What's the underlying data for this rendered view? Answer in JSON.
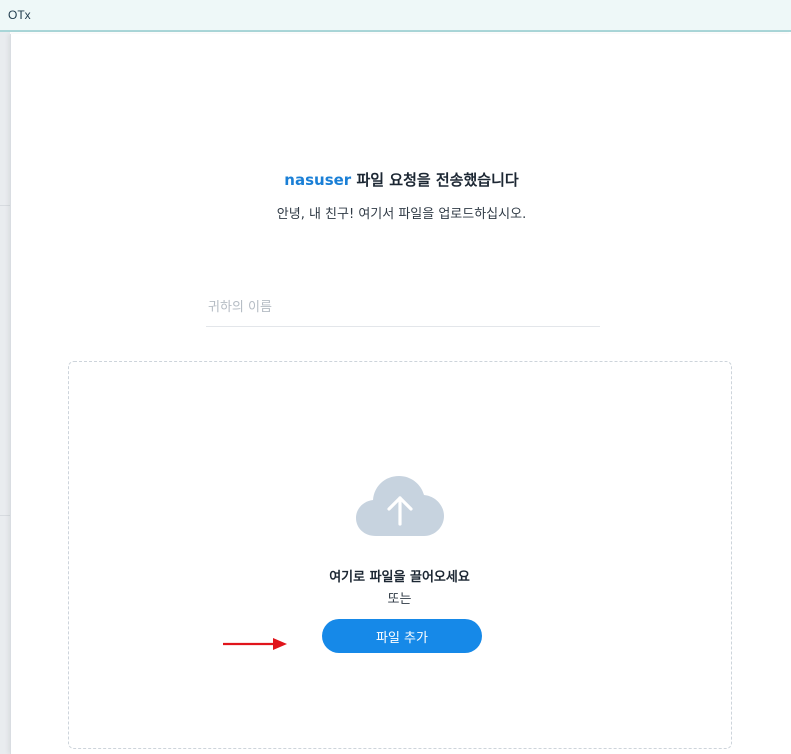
{
  "window": {
    "title": "OTx"
  },
  "request": {
    "username": "nasuser",
    "heading_suffix": " 파일 요청을 전송했습니다",
    "message": "안녕, 내 친구! 여기서 파일을 업로드하십시오."
  },
  "name_input": {
    "placeholder": "귀하의 이름",
    "value": ""
  },
  "dropzone": {
    "prompt": "여기로 파일을 끌어오세요",
    "or": "또는",
    "add_button_label": "파일 추가"
  },
  "icons": {
    "upload": "cloud-upload-icon",
    "annotation": "red-arrow-icon"
  },
  "colors": {
    "accent": "#1689e8",
    "username": "#1a7fd6",
    "annotation_arrow": "#e0141b",
    "cloud": "#c7d3df"
  }
}
